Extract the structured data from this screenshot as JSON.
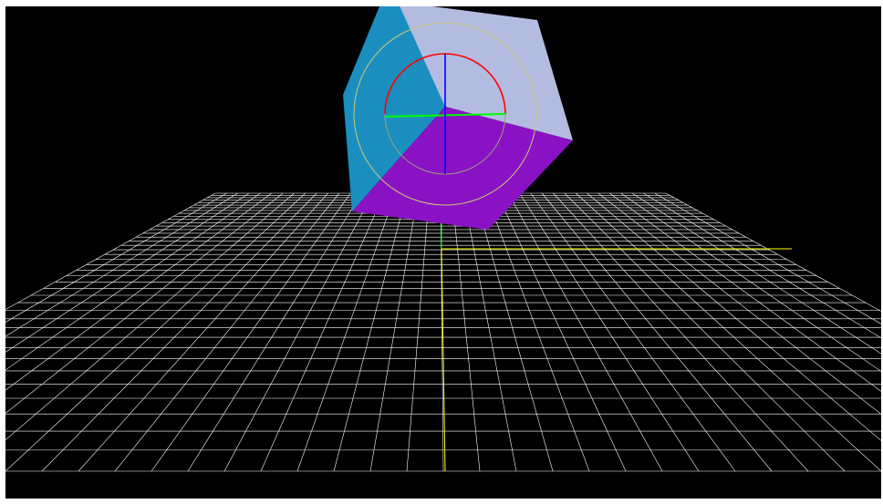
{
  "viewport": {
    "background": "#000000",
    "frame_color": "#ffffff"
  },
  "scene": {
    "grid": {
      "line_color": "#ffffff",
      "axis_x_color": "#ffff00",
      "axis_z_color": "#ffff00",
      "axis_y_color": "#00ff00"
    },
    "cube": {
      "top_face_color": "#b3bce0",
      "left_face_color": "#1a8fbf",
      "front_face_color": "#8a12c4"
    },
    "rotate_gizmo": {
      "outer_ring_color": "#c9c978",
      "x_ring_color": "#ff0000",
      "y_ring_color": "#00ff00",
      "z_ring_color": "#0000ff",
      "inner_ring_color": "#9aa07a"
    }
  }
}
